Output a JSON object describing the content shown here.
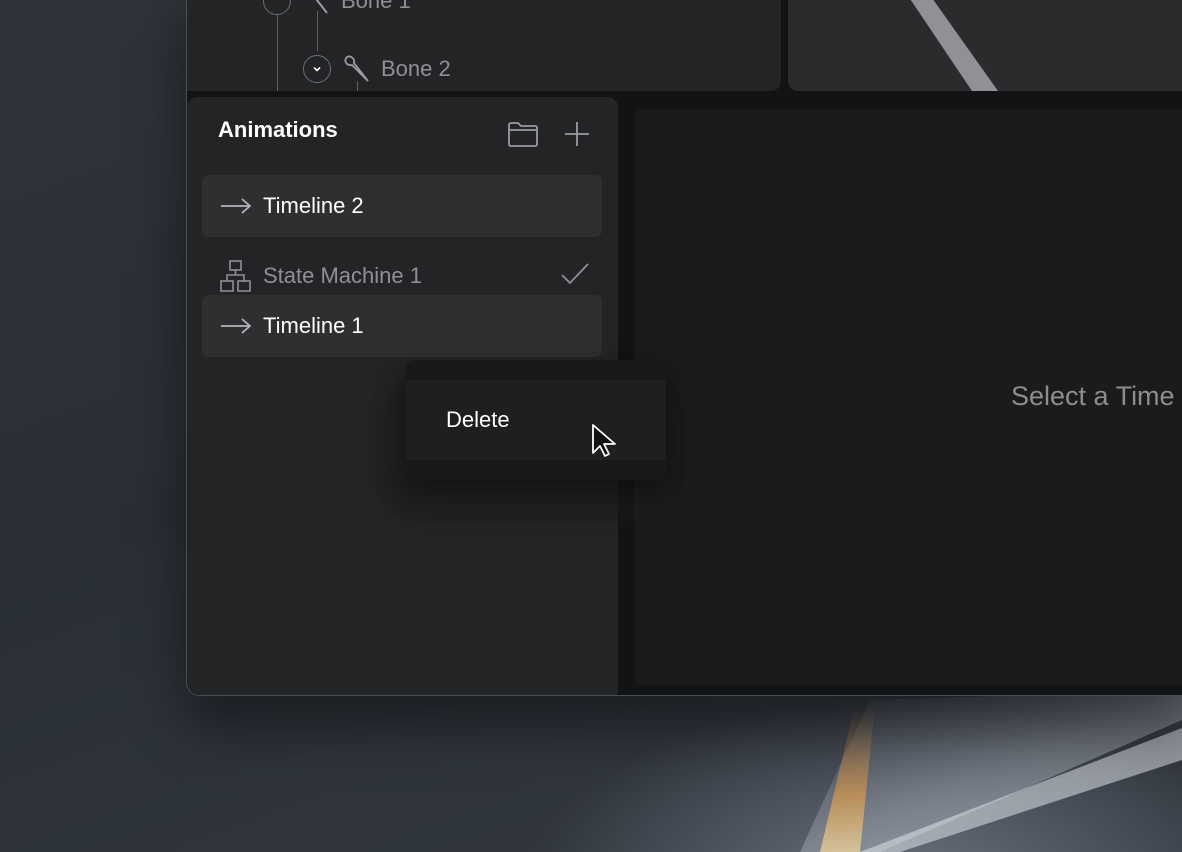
{
  "hierarchy": {
    "nodes": [
      {
        "label": "Bone 1",
        "icon": "bone-icon"
      },
      {
        "label": "Bone 2",
        "icon": "bone-icon",
        "toggle": "chevron-down-icon"
      }
    ]
  },
  "animations": {
    "title": "Animations",
    "actions": [
      {
        "icon": "folder-icon"
      },
      {
        "icon": "plus-icon"
      }
    ],
    "items": [
      {
        "label": "Timeline 2",
        "icon": "arrow-right-icon",
        "selected": true
      },
      {
        "label": "State Machine 1",
        "icon": "state-machine-icon",
        "selected": false,
        "status_icon": "checkmark-icon"
      },
      {
        "label": "Timeline 1",
        "icon": "arrow-right-icon",
        "selected": true
      }
    ]
  },
  "timeline": {
    "empty_hint": "Select a Time"
  },
  "context_menu": {
    "items": [
      {
        "label": "Delete"
      }
    ]
  },
  "colors": {
    "panel_bg": "#232425",
    "selected_row_bg": "#2e2f31",
    "text_primary": "#ffffff",
    "text_muted": "#8e9094"
  }
}
